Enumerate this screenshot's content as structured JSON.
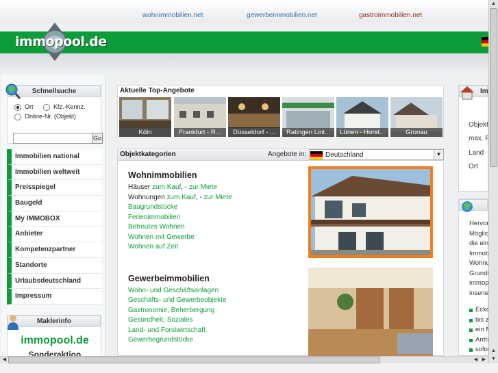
{
  "toplinks": [
    "wohnimmobilien.net",
    "gewerbeimmobilien.net",
    "gastroimmobilien.net"
  ],
  "logo": "immopool.de",
  "schnellsuche": {
    "title": "Schnellsuche",
    "opt_ort": "Ort",
    "opt_kfz": "Kfz.-Kennz.",
    "opt_online": "Online-Nr. (Objekt)",
    "go": "Go"
  },
  "nav": [
    "Immobilien national",
    "Immobilien weltweit",
    "Preisspiegel",
    "Baugeld",
    "My IMMOBOX",
    "Anbieter",
    "Kompetenzpartner",
    "Standorte",
    "Urlaubsdeutschland",
    "Impressum"
  ],
  "makler": {
    "title": "Maklerinfo",
    "brand": "immopool.de",
    "sub": "Sonderaktion"
  },
  "top": {
    "title": "Aktuelle Top-Angebote",
    "cities": [
      "Köln",
      "Frankfurt - R...",
      "Düsseldorf - ...",
      "Ratingen Lint...",
      "Lünen - Horst...",
      "Gronau"
    ]
  },
  "kat": {
    "title": "Objektkategorien",
    "angebote": "Angebote in:",
    "country": "Deutschland",
    "wohn_title": "Wohnimmobilien",
    "haeuser": "Häuser",
    "wohnungen": "Wohnungen",
    "zum_kauf": "zum Kauf",
    "zur_miete": "zur Miete",
    "sep": ", -",
    "wohn_links": [
      "Baugrundstücke",
      "Ferienimmobilien",
      "Betreutes Wohnen",
      "Wohnen mit Gewerbe",
      "Wohnen auf Zeit"
    ],
    "gew_title": "Gewerbeimmobilien",
    "gew_links": [
      "Wohn- und Geschäftsanlagen",
      "Geschäfts- und Gewerbeobjekte",
      "Gastronomie, Beherbergung",
      "Gesundheit, Soziales",
      "Land- und Forstwirtschaft",
      "Gewerbegrundstücke"
    ]
  },
  "right": {
    "box1_title": "Im",
    "box1_lines": [
      "Objekta",
      "max. P",
      "Land",
      "Ort"
    ],
    "box2_lines": [
      "Hervor",
      "Möglich",
      "die eina",
      "Immobi",
      "Wohnu",
      "Grunds",
      "immopo",
      "inserier"
    ],
    "bullets": [
      "Ecko",
      "bis z",
      "ein M",
      "Anfra",
      "sofor"
    ]
  }
}
